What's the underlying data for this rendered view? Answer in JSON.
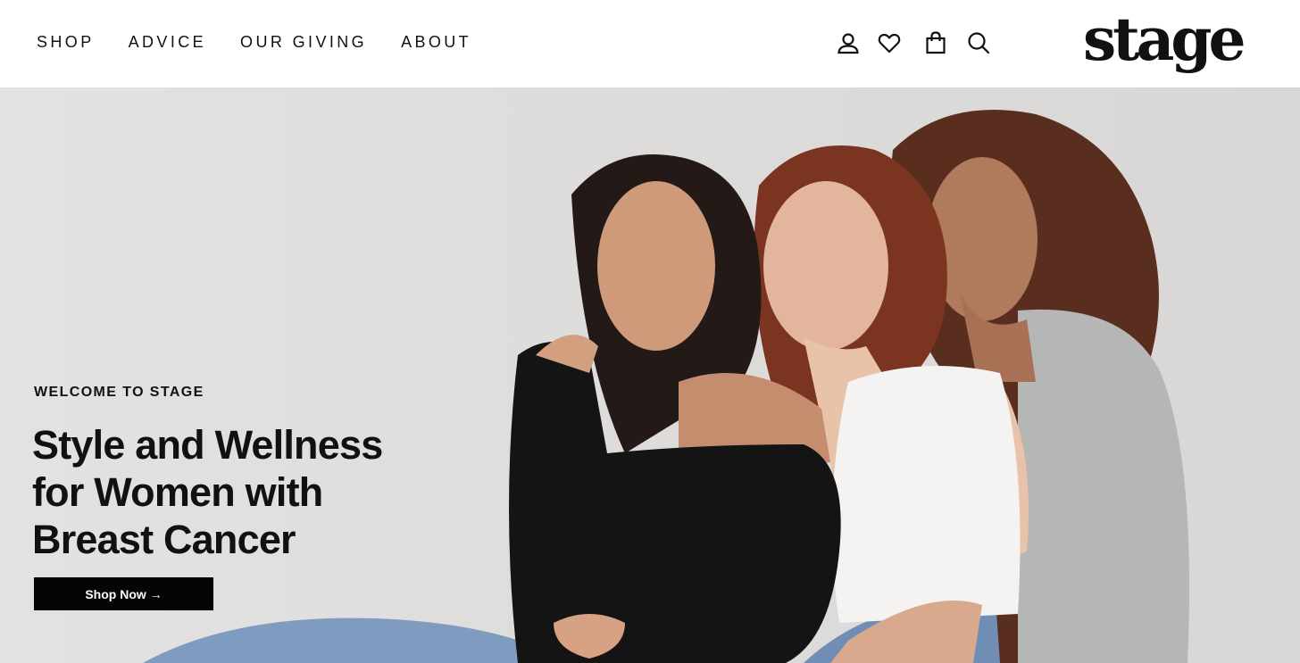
{
  "header": {
    "nav": [
      {
        "label": "SHOP"
      },
      {
        "label": "ADVICE"
      },
      {
        "label": "OUR GIVING"
      },
      {
        "label": "ABOUT"
      }
    ],
    "icons": [
      "account-icon",
      "heart-icon",
      "shopping-bag-icon",
      "search-icon"
    ],
    "logo": "stage"
  },
  "hero": {
    "eyebrow": "WELCOME TO STAGE",
    "headline_lines": [
      "Style and Wellness",
      "for Women with",
      "Breast Cancer"
    ],
    "cta_label": "Shop Now →",
    "photo_description": "hero-photo"
  },
  "colors": {
    "text": "#111111",
    "cta_background": "#050505",
    "hero_background": "#dedddc"
  }
}
